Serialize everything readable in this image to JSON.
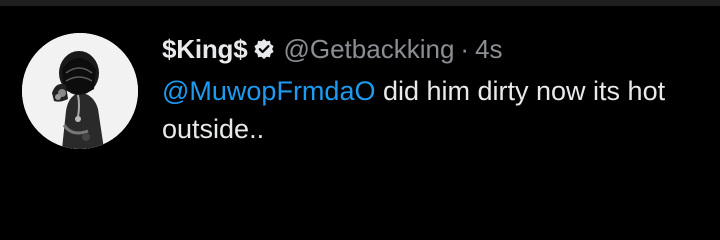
{
  "tweet": {
    "display_name": "$King$",
    "handle": "@Getbackking",
    "separator": "·",
    "time": "4s",
    "mention": "@MuwopFrmdaO",
    "text_rest": " did him dirty now its hot outside..",
    "verified": true,
    "avatar_icon": "avatar-image",
    "verified_icon": "verified-badge-icon"
  },
  "colors": {
    "background": "#000000",
    "text": "#e7e9ea",
    "muted": "#8b8f94",
    "link": "#1d9bf0"
  }
}
